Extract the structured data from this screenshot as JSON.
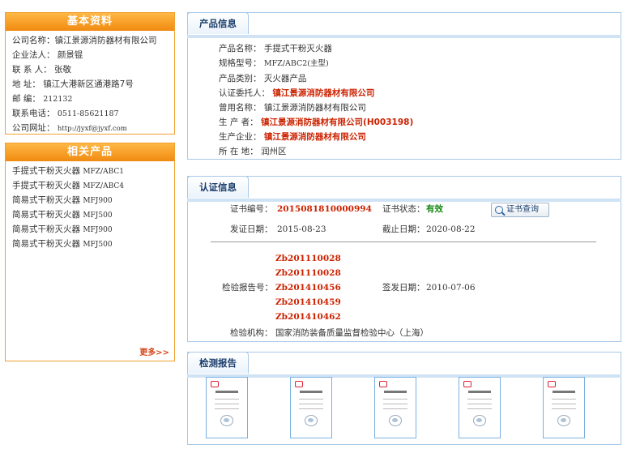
{
  "basic": {
    "title": "基本资料",
    "rows": [
      {
        "label": "公司名称：",
        "value": "镇江景源消防器材有限公司"
      },
      {
        "label": "企业法人：",
        "value": "颜景锟"
      },
      {
        "label": "联 系 人：",
        "value": "张敬"
      },
      {
        "label": "地  址：",
        "value": "镇江大港新区通港路7号"
      },
      {
        "label": "邮  编：",
        "value": "212132"
      },
      {
        "label": "联系电话：",
        "value": "0511-85621187"
      },
      {
        "label": "公司网址：",
        "value": "http://jyxf@jyxf.com"
      }
    ]
  },
  "related": {
    "title": "相关产品",
    "items": [
      {
        "name": "手提式干粉灭火器",
        "model": "MFZ/ABC1"
      },
      {
        "name": "手提式干粉灭火器",
        "model": "MFZ/ABC4"
      },
      {
        "name": "简易式干粉灭火器",
        "model": "MFJ900"
      },
      {
        "name": "简易式干粉灭火器",
        "model": "MFJ500"
      },
      {
        "name": "简易式干粉灭火器",
        "model": "MFJ900"
      },
      {
        "name": "简易式干粉灭火器",
        "model": "MFJ500"
      }
    ],
    "more": "更多>>"
  },
  "product": {
    "tab": "产品信息",
    "rows": [
      {
        "label": "产品名称：",
        "value": "手提式干粉灭火器"
      },
      {
        "label": "规格型号：",
        "value": "MFZ/ABC2(主型)"
      },
      {
        "label": "产品类别：",
        "value": "灭火器产品"
      },
      {
        "label": "认证委托人：",
        "value": "镇江景源消防器材有限公司"
      },
      {
        "label": "曾用名称：",
        "value": "镇江景源消防器材有限公司"
      },
      {
        "label": "生 产 者：",
        "value": "镇江景源消防器材有限公司(H003198)"
      },
      {
        "label": "生产企业：",
        "value": "镇江景源消防器材有限公司"
      },
      {
        "label": "所 在 地：",
        "value": "润州区"
      }
    ]
  },
  "cert": {
    "tab": "认证信息",
    "cert_no_label": "证书编号：",
    "cert_no": "2015081810000994",
    "status_label": "证书状态：",
    "status": "有效",
    "query_btn": "证书查询",
    "issue_label": "发证日期：",
    "issue_date": "2015-08-23",
    "expire_label": "截止日期：",
    "expire_date": "2020-08-22",
    "report_label": "检验报告号：",
    "reports": [
      "Zb201110028",
      "Zb201110028",
      "Zb201410456",
      "Zb201410459",
      "Zb201410462"
    ],
    "sign_label": "签发日期：",
    "sign_date": "2010-07-06",
    "org_label": "检验机构：",
    "org": "国家消防装备质量监督检验中心（上海）"
  },
  "test": {
    "tab": "检测报告",
    "count": 5
  },
  "colors": {
    "orange": "#f08a10",
    "blue_border": "#a9c9e8",
    "red": "#cc2200",
    "green": "#178a14"
  }
}
